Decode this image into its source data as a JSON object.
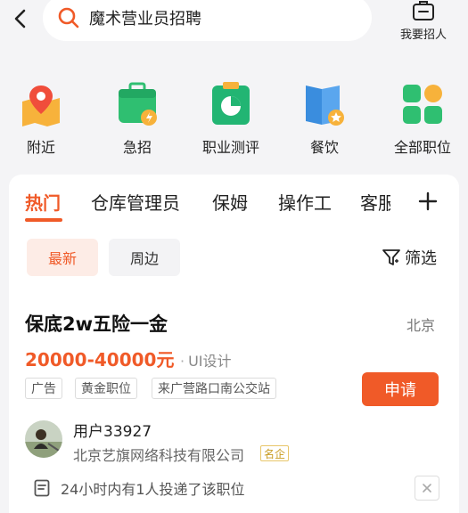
{
  "header": {
    "search_query": "魔术营业员招聘",
    "post_job_label": "我要招人",
    "icons": {
      "back": "back-arrow-icon",
      "search": "search-icon",
      "post_job": "briefcase-icon"
    }
  },
  "categories": [
    {
      "label": "附近",
      "icon": "map-pin-icon",
      "color": "#f5a623"
    },
    {
      "label": "急招",
      "icon": "urgent-bag-icon",
      "color": "#2fbf71"
    },
    {
      "label": "职业测评",
      "icon": "chart-clipboard-icon",
      "color": "#22b573"
    },
    {
      "label": "餐饮",
      "icon": "menu-book-icon",
      "color": "#3a8dde"
    },
    {
      "label": "全部职位",
      "icon": "grid-icon",
      "color": "#2fbf71"
    }
  ],
  "tabs": {
    "items": [
      "热门",
      "仓库管理员",
      "保姆",
      "操作工",
      "客服"
    ],
    "active_index": 0,
    "add_icon": "plus-icon"
  },
  "filters": {
    "chips": [
      "最新",
      "周边"
    ],
    "active_chip": 0,
    "filter_label": "筛选",
    "filter_icon": "funnel-icon"
  },
  "job": {
    "title": "保底2w五险一金",
    "city": "北京",
    "salary": "20000-40000元",
    "type_sep": "·",
    "type": "UI设计",
    "tags": [
      "广告",
      "黄金职位",
      "来广营路口南公交站"
    ],
    "apply_label": "申请",
    "user_name": "用户33927",
    "company": "北京艺旗网络科技有限公司",
    "company_badge": "名企",
    "notice": "24小时内有1人投递了该职位",
    "notice_icon": "document-icon",
    "close_icon": "close-icon"
  },
  "colors": {
    "accent": "#f05a28",
    "background": "#f4f4f6",
    "badge": "#c89a20"
  }
}
